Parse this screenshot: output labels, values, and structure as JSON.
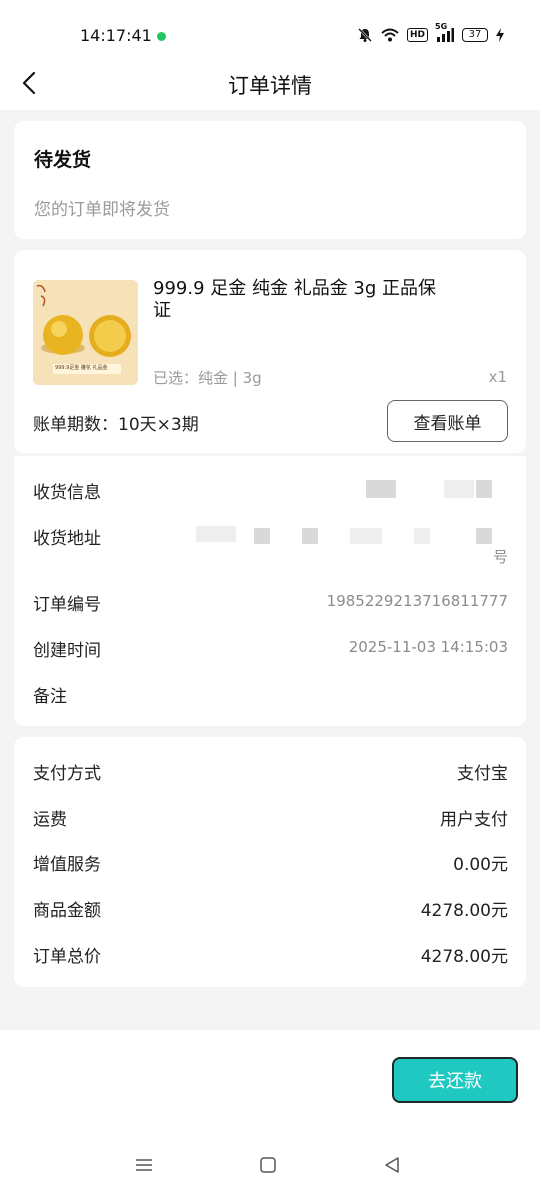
{
  "status_bar": {
    "time": "14:17:41",
    "hd": "HD",
    "signal_label": "5G",
    "battery": "37"
  },
  "header": {
    "title": "订单详情"
  },
  "order_status": {
    "title": "待发货",
    "subtitle": "您的订单即将发货"
  },
  "product": {
    "title": "999.9 足金 纯金 礼品金 3g 正品保证",
    "spec": "已选：纯金 | 3g",
    "quantity": "x1",
    "thumb_caption": "999.9足金 雕花 礼品金",
    "bill_label": "账单期数：10天×3期",
    "bill_button": "查看账单"
  },
  "info": {
    "rows": [
      {
        "label": "收货信息"
      },
      {
        "label": "收货地址",
        "value_tail": "号"
      },
      {
        "label": "订单编号",
        "value": "1985229213716811777"
      },
      {
        "label": "创建时间",
        "value": "2025-11-03 14:15:03"
      },
      {
        "label": "备注",
        "value": ""
      }
    ]
  },
  "payment": {
    "rows": [
      {
        "label": "支付方式",
        "value": "支付宝"
      },
      {
        "label": "运费",
        "value": "用户支付"
      },
      {
        "label": "增值服务",
        "value": "0.00元"
      },
      {
        "label": "商品金额",
        "value": "4278.00元"
      },
      {
        "label": "订单总价",
        "value": "4278.00元"
      }
    ]
  },
  "footer": {
    "repay_button": "去还款"
  },
  "colors": {
    "accent": "#1fc9c1",
    "background": "#f4f4f4",
    "muted_text": "#9a9a9a"
  }
}
